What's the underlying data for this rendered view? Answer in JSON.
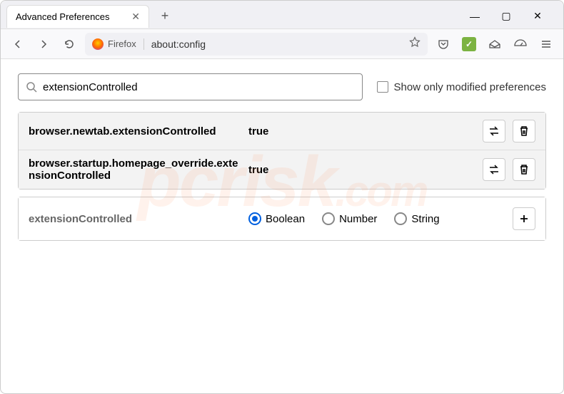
{
  "window": {
    "tab_title": "Advanced Preferences",
    "minimize_glyph": "—",
    "maximize_glyph": "▢",
    "close_glyph": "✕"
  },
  "navbar": {
    "identity_label": "Firefox",
    "url": "about:config"
  },
  "search": {
    "value": "extensionControlled",
    "checkbox_label": "Show only modified preferences"
  },
  "prefs": [
    {
      "name": "browser.newtab.extensionControlled",
      "value": "true"
    },
    {
      "name": "browser.startup.homepage_override.extensionControlled",
      "value": "true"
    }
  ],
  "add_row": {
    "name": "extensionControlled",
    "types": [
      "Boolean",
      "Number",
      "String"
    ],
    "selected": "Boolean"
  },
  "watermark": {
    "text": "pcrisk",
    "tld": ".com"
  }
}
